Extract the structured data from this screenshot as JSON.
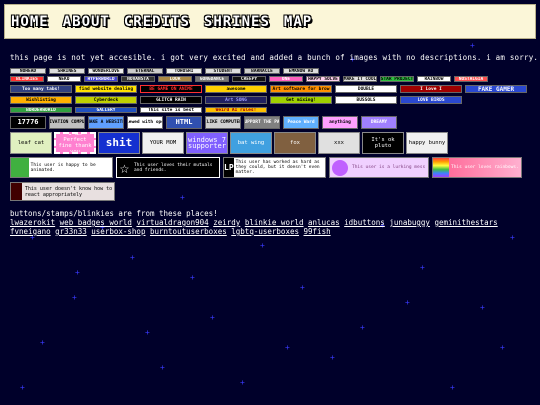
{
  "nav": {
    "home": "HOME",
    "about": "ABOUT",
    "credits": "CREDITS",
    "shrines": "SHRINES",
    "map": "MAP"
  },
  "notice": "this page is not yet accesible. i got very excited and added a bunch of images with no descriptions. i am sorry.",
  "row1": [
    "NOHEAD",
    "SHRINES",
    "WONDERLOVE",
    "ETERNAL",
    "TOHOSHI",
    "STUDENT",
    "BARNACLE",
    "EMKNOW AO"
  ],
  "row2": [
    "BLINKIES",
    "NEKO",
    "HYPERWORLD",
    "NOVANSTA",
    "LOUR",
    "GONGDANCE",
    "CREEPY",
    "ONE",
    "HAPPY SOLVE",
    "MAKE IT COOL",
    "STAR PROJECT",
    "RAINBOW",
    "NOSTALGIA"
  ],
  "row3": [
    "Too many tabs!",
    "find website dealing",
    "BE GAME ON ANIME",
    "awesome",
    "Art software for brow",
    "DOUBLE",
    "I Love I",
    "FAKE GAMER"
  ],
  "row4": [
    "Wishlisting",
    "Cyberdeck",
    "GLITCH RAIN",
    "Art SONG",
    "Get mixing!",
    "BUSSOLS",
    "LOVE BIRDS"
  ],
  "row5": [
    "BORDERWORLD",
    "GALLERY",
    "This site is best",
    "Weird AI rules!"
  ],
  "row6": [
    "17776",
    "ACTIVATION COMPUTER",
    "MAKE A WEBSITE",
    "best viewed with open eyes",
    "HTML",
    "ILIKE COMPUTER",
    "I SUPPORT THE PARTY",
    "Peace Ward",
    "anything",
    "DREAMY"
  ],
  "stamps": [
    "leaf cat",
    "I am Perfect fine thank you",
    "shit",
    "YOUR MOM",
    "windows 7 supporter",
    "bat wing",
    "fox",
    "xxx",
    "It's ok pluto",
    "happy bunny"
  ],
  "userboxes": [
    "This user is happy to be animated.",
    "This user loves their mutuals and friends.",
    "This user has worked as hard as they could, but it doesn't even matter.",
    "This user is a lurking mess",
    "This user loves rainbows."
  ],
  "lastbox": "This user doesn't know how to react appropriately",
  "credits_intro": "buttons/stamps/blinkies are from these places!",
  "credit_links": [
    "lwazerokit",
    "web badges world",
    "virtualdragon904",
    "zeirdy",
    "blinkie world",
    "anlucas",
    "idbuttons",
    "junabuggy",
    "geminithestars",
    "fvneigano",
    "gr33n33",
    "userbox-shop",
    "burntoutuserboxes",
    "lgbtq-userboxes",
    "99fish"
  ]
}
